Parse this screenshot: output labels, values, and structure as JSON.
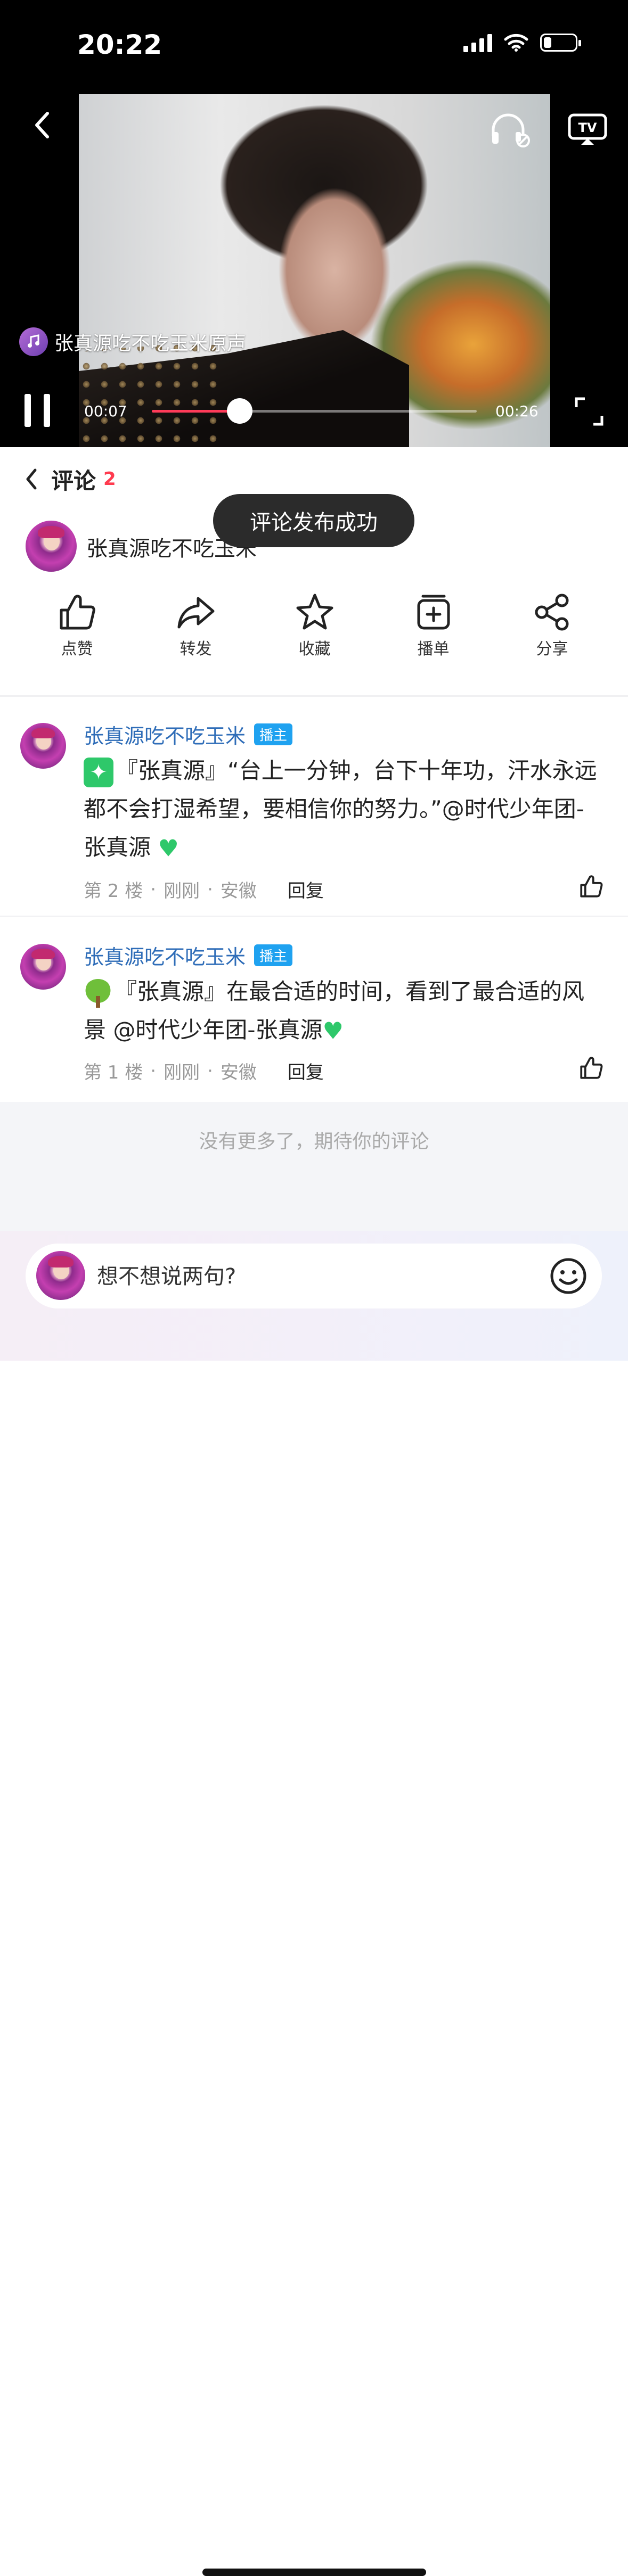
{
  "status_bar": {
    "time": "20:22"
  },
  "player": {
    "sound_name": "张真源吃不吃玉米原声",
    "current_time": "00:07",
    "total_time": "00:26",
    "progress_fraction": 0.27,
    "accent_color": "#ff3b59"
  },
  "comments_header": {
    "title": "评论",
    "count": "2"
  },
  "video_info": {
    "title": "张真源吃不吃玉米"
  },
  "toast": {
    "text": "评论发布成功"
  },
  "actions": [
    {
      "label": "点赞",
      "icon": "thumbs-up-icon"
    },
    {
      "label": "转发",
      "icon": "forward-icon"
    },
    {
      "label": "收藏",
      "icon": "star-icon"
    },
    {
      "label": "播单",
      "icon": "playlist-add-icon"
    },
    {
      "label": "分享",
      "icon": "share-icon"
    }
  ],
  "comments": [
    {
      "user": "张真源吃不吃玉米",
      "badge": "播主",
      "text": "『张真源』“台上一分钟，台下十年功，汗水永远都不会打湿希望，要相信你的努力。”@时代少年团-张真源 ",
      "floor": "第 2 楼",
      "time": "刚刚",
      "location": "安徽",
      "reply_label": "回复"
    },
    {
      "user": "张真源吃不吃玉米",
      "badge": "播主",
      "text": "『张真源』在最合适的时间，看到了最合适的风景 @时代少年团-张真源",
      "floor": "第 1 楼",
      "time": "刚刚",
      "location": "安徽",
      "reply_label": "回复"
    }
  ],
  "footer": {
    "no_more_text": "没有更多了，期待你的评论"
  },
  "input": {
    "placeholder": "想不想说两句?"
  },
  "colors": {
    "name_blue": "#2f6db8",
    "badge_blue": "#1fa2f0",
    "count_red": "#ff3b4f"
  }
}
